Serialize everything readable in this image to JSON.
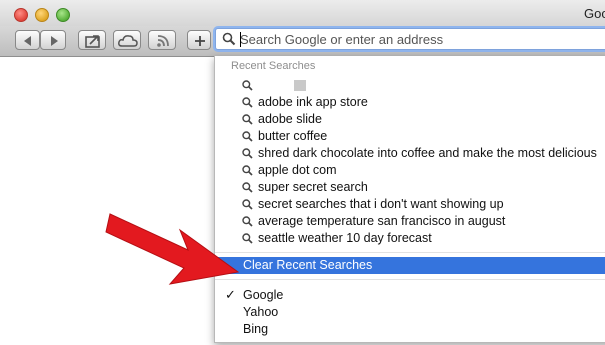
{
  "window": {
    "title": "Goo"
  },
  "address_bar": {
    "placeholder": "Search Google or enter an address"
  },
  "dropdown": {
    "recent_title": "Recent Searches",
    "recent_items": [
      "",
      "adobe ink app store",
      "adobe slide",
      "butter coffee",
      "shred dark chocolate into coffee and make the most delicious",
      "apple dot com",
      "super secret search",
      "secret searches that i don't want showing up",
      "average temperature san francisco in august",
      "seattle weather 10 day forecast"
    ],
    "clear_label": "Clear Recent Searches",
    "search_engines": [
      {
        "name": "Google",
        "selected": true,
        "check": "✓"
      },
      {
        "name": "Yahoo",
        "selected": false
      },
      {
        "name": "Bing",
        "selected": false
      }
    ]
  },
  "colors": {
    "selection": "#3574dd",
    "arrow": "#e3191f",
    "focus_ring": "#8fb5ee"
  }
}
